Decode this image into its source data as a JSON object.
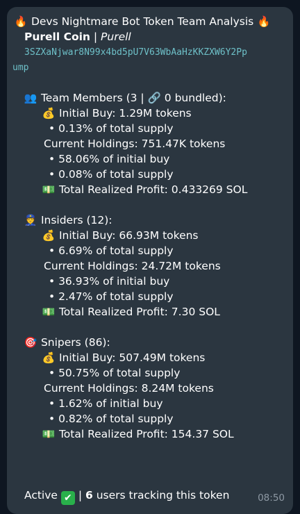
{
  "message": {
    "title": "Devs Nightmare Bot Token Team Analysis",
    "title_emoji_left": "🔥",
    "title_emoji_right": "🔥",
    "coin_name": "Purell Coin",
    "coin_sep": " | ",
    "coin_alias": "Purell",
    "address_line1": "3SZXaNjwar8N99x4bd5pU7V63WbAaHzKKZXW6Y2Pp",
    "address_line2": "ump",
    "team": {
      "emoji": "👥",
      "header": "Team Members (3 | 🔗 0 bundled):",
      "initial_buy": "Initial Buy: 1.29M tokens",
      "initial_pct": "• 0.13% of total supply",
      "current": "Current Holdings: 751.47K tokens",
      "current_pct_initial": "• 58.06% of initial buy",
      "current_pct_total": "• 0.08% of total supply",
      "profit": "Total Realized Profit: 0.433269 SOL"
    },
    "insiders": {
      "emoji": "👮",
      "header": "Insiders (12):",
      "initial_buy": "Initial Buy: 66.93M tokens",
      "initial_pct": "• 6.69% of total supply",
      "current": "Current Holdings: 24.72M tokens",
      "current_pct_initial": "• 36.93% of initial buy",
      "current_pct_total": "• 2.47% of total supply",
      "profit": "Total Realized Profit: 7.30 SOL"
    },
    "snipers": {
      "emoji": "🎯",
      "header": "Snipers (86):",
      "initial_buy": "Initial Buy: 507.49M tokens",
      "initial_pct": "• 50.75% of total supply",
      "current": "Current Holdings: 8.24M tokens",
      "current_pct_initial": "• 1.62% of initial buy",
      "current_pct_total": "• 0.82% of total supply",
      "profit": "Total Realized Profit: 154.37 SOL"
    },
    "moneybag_emoji": "💰",
    "profit_emoji": "💵",
    "footer": {
      "active": "Active",
      "check": "✔",
      "sep": " | ",
      "users_count": "6",
      "users_text": " users tracking this token"
    },
    "time": "08:50"
  }
}
